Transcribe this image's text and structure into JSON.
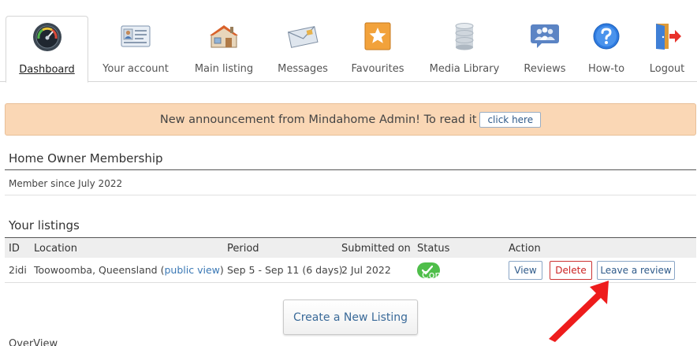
{
  "tabs": [
    {
      "label": "Dashboard",
      "icon": "speedometer-icon",
      "active": true
    },
    {
      "label": "Your account",
      "icon": "id-card-icon",
      "active": false
    },
    {
      "label": "Main listing",
      "icon": "house-icon",
      "active": false
    },
    {
      "label": "Messages",
      "icon": "envelope-icon",
      "active": false
    },
    {
      "label": "Favourites",
      "icon": "star-icon",
      "active": false
    },
    {
      "label": "Media Library",
      "icon": "database-icon",
      "active": false
    },
    {
      "label": "Reviews",
      "icon": "people-icon",
      "active": false
    },
    {
      "label": "How-to",
      "icon": "help-icon",
      "active": false
    },
    {
      "label": "Logout",
      "icon": "door-exit-icon",
      "active": false
    }
  ],
  "announcement": {
    "text": "New announcement from Mindahome Admin! To read it",
    "button": "click here"
  },
  "membership": {
    "title": "Home Owner Membership",
    "since": "Member since July 2022"
  },
  "listings": {
    "title": "Your listings",
    "columns": [
      "ID",
      "Location",
      "Period",
      "Submitted on",
      "Status",
      "Action"
    ],
    "rows": [
      {
        "id": "2idi",
        "location": "Toowoomba, Queensland",
        "public_view_open": "(",
        "public_view": "public view",
        "public_view_close": ")",
        "period": "Sep 5 - Sep 11 (6 days)",
        "submitted": "2 Jul 2022",
        "status": "Completed",
        "actions": [
          "View",
          "Delete",
          "Leave a review"
        ]
      }
    ]
  },
  "create_button": "Create a New Listing",
  "next_section_cutoff": "OverView",
  "colors": {
    "announcement_bg": "#fad7b5",
    "status_green": "#4fbe4a",
    "delete_red": "#cc2222",
    "link_blue": "#3a78b5",
    "arrow_red": "#ee1c1c"
  }
}
